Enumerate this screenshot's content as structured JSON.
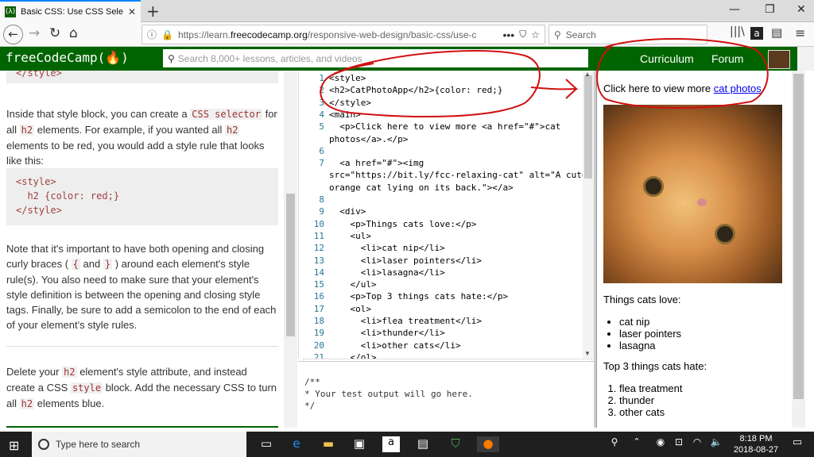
{
  "browser": {
    "tab_title": "Basic CSS: Use CSS Selectors to",
    "url_host": "https://learn.",
    "url_domain": "freecodecamp.org",
    "url_path": "/responsive-web-design/basic-css/use-c",
    "search_placeholder": "Search"
  },
  "fcc": {
    "logo": "freeCodeCamp(🔥)",
    "search_placeholder": "Search 8,000+ lessons, articles, and videos",
    "nav": [
      "Curriculum",
      "Forum"
    ]
  },
  "lesson": {
    "top_code": "</style>",
    "p1_a": "Inside that style block, you can create a",
    "p1_code1": "CSS selector",
    "p1_b": "for all",
    "p1_code2": "h2",
    "p1_c": "elements. For example, if you wanted all",
    "p1_code3": "h2",
    "p1_d": "elements to be red, you would add a style rule that looks like this:",
    "code_lines": [
      "<style>",
      "  h2 {color: red;}",
      "</style>"
    ],
    "p2_a": "Note that it's important to have both opening and closing curly braces (",
    "p2_code1": "{",
    "p2_b": "and",
    "p2_code2": "}",
    "p2_c": ") around each element's style rule(s). You also need to make sure that your element's style definition is between the opening and closing style tags. Finally, be sure to add a semicolon to the end of each of your element's style rules.",
    "p3_a": "Delete your",
    "p3_code1": "h2",
    "p3_b": "element's style attribute, and instead create a CSS",
    "p3_code2": "style",
    "p3_c": "block. Add the necessary CSS to turn all",
    "p3_code3": "h2",
    "p3_d": "elements blue."
  },
  "editor": {
    "lines": [
      {
        "n": "1",
        "t": "<style>"
      },
      {
        "n": "2",
        "t": "<h2>CatPhotoApp</h2>{color: red;}"
      },
      {
        "n": "3",
        "t": "</style>"
      },
      {
        "n": "4",
        "t": "<main>"
      },
      {
        "n": "5",
        "t": "  <p>Click here to view more <a href=\"#\">cat"
      },
      {
        "n": "",
        "t": "photos</a>.</p>"
      },
      {
        "n": "6",
        "t": ""
      },
      {
        "n": "7",
        "t": "  <a href=\"#\"><img"
      },
      {
        "n": "",
        "t": "src=\"https://bit.ly/fcc-relaxing-cat\" alt=\"A cute"
      },
      {
        "n": "",
        "t": "orange cat lying on its back.\"></a>"
      },
      {
        "n": "8",
        "t": ""
      },
      {
        "n": "9",
        "t": "  <div>"
      },
      {
        "n": "10",
        "t": "    <p>Things cats love:</p>"
      },
      {
        "n": "11",
        "t": "    <ul>"
      },
      {
        "n": "12",
        "t": "      <li>cat nip</li>"
      },
      {
        "n": "13",
        "t": "      <li>laser pointers</li>"
      },
      {
        "n": "14",
        "t": "      <li>lasagna</li>"
      },
      {
        "n": "15",
        "t": "    </ul>"
      },
      {
        "n": "16",
        "t": "    <p>Top 3 things cats hate:</p>"
      },
      {
        "n": "17",
        "t": "    <ol>"
      },
      {
        "n": "18",
        "t": "      <li>flea treatment</li>"
      },
      {
        "n": "19",
        "t": "      <li>thunder</li>"
      },
      {
        "n": "20",
        "t": "      <li>other cats</li>"
      },
      {
        "n": "21",
        "t": "    </ol>"
      }
    ],
    "output_lines": [
      "/**",
      "* Your test output will go here.",
      "*/"
    ]
  },
  "preview": {
    "click_text": "Click here to view more ",
    "link_text": "cat photos",
    "after_link": ".",
    "love_heading": "Things cats love:",
    "love_items": [
      "cat nip",
      "laser pointers",
      "lasagna"
    ],
    "hate_heading": "Top 3 things cats hate:",
    "hate_items": [
      "flea treatment",
      "thunder",
      "other cats"
    ]
  },
  "taskbar": {
    "search_placeholder": "Type here to search",
    "time": "8:18 PM",
    "date": "2018-08-27"
  }
}
